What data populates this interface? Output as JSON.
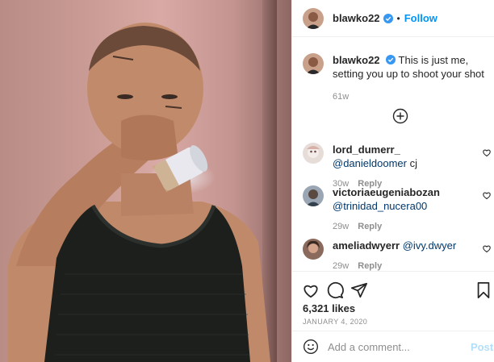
{
  "post": {
    "author": "blawko22",
    "follow_label": "Follow",
    "dot": "•",
    "caption": "This is just me, setting you up to shoot your shot",
    "caption_time": "61w",
    "likes": "6,321 likes",
    "date": "January 4, 2020"
  },
  "comments": [
    {
      "username": "lord_dumerr_",
      "mention": "@danieldoomer",
      "text": " cj",
      "time": "30w",
      "reply_label": "Reply"
    },
    {
      "username": "victoriaeugeniabozan",
      "mention": "@trinidad_nucera00",
      "text": "",
      "time": "29w",
      "reply_label": "Reply"
    },
    {
      "username": "ameliadwyerr",
      "mention": "@ivy.dwyer",
      "text": "",
      "time": "29w",
      "reply_label": "Reply"
    }
  ],
  "composer": {
    "placeholder": "Add a comment...",
    "post_label": "Post"
  },
  "colors": {
    "accent": "#0095f6",
    "post_disabled": "#b2dffc",
    "mention": "#00376b",
    "verified": "#3897f0"
  },
  "icons": [
    "verified-badge-icon",
    "add-circle-icon",
    "heart-icon",
    "comment-icon",
    "share-icon",
    "bookmark-icon",
    "emoji-icon"
  ]
}
